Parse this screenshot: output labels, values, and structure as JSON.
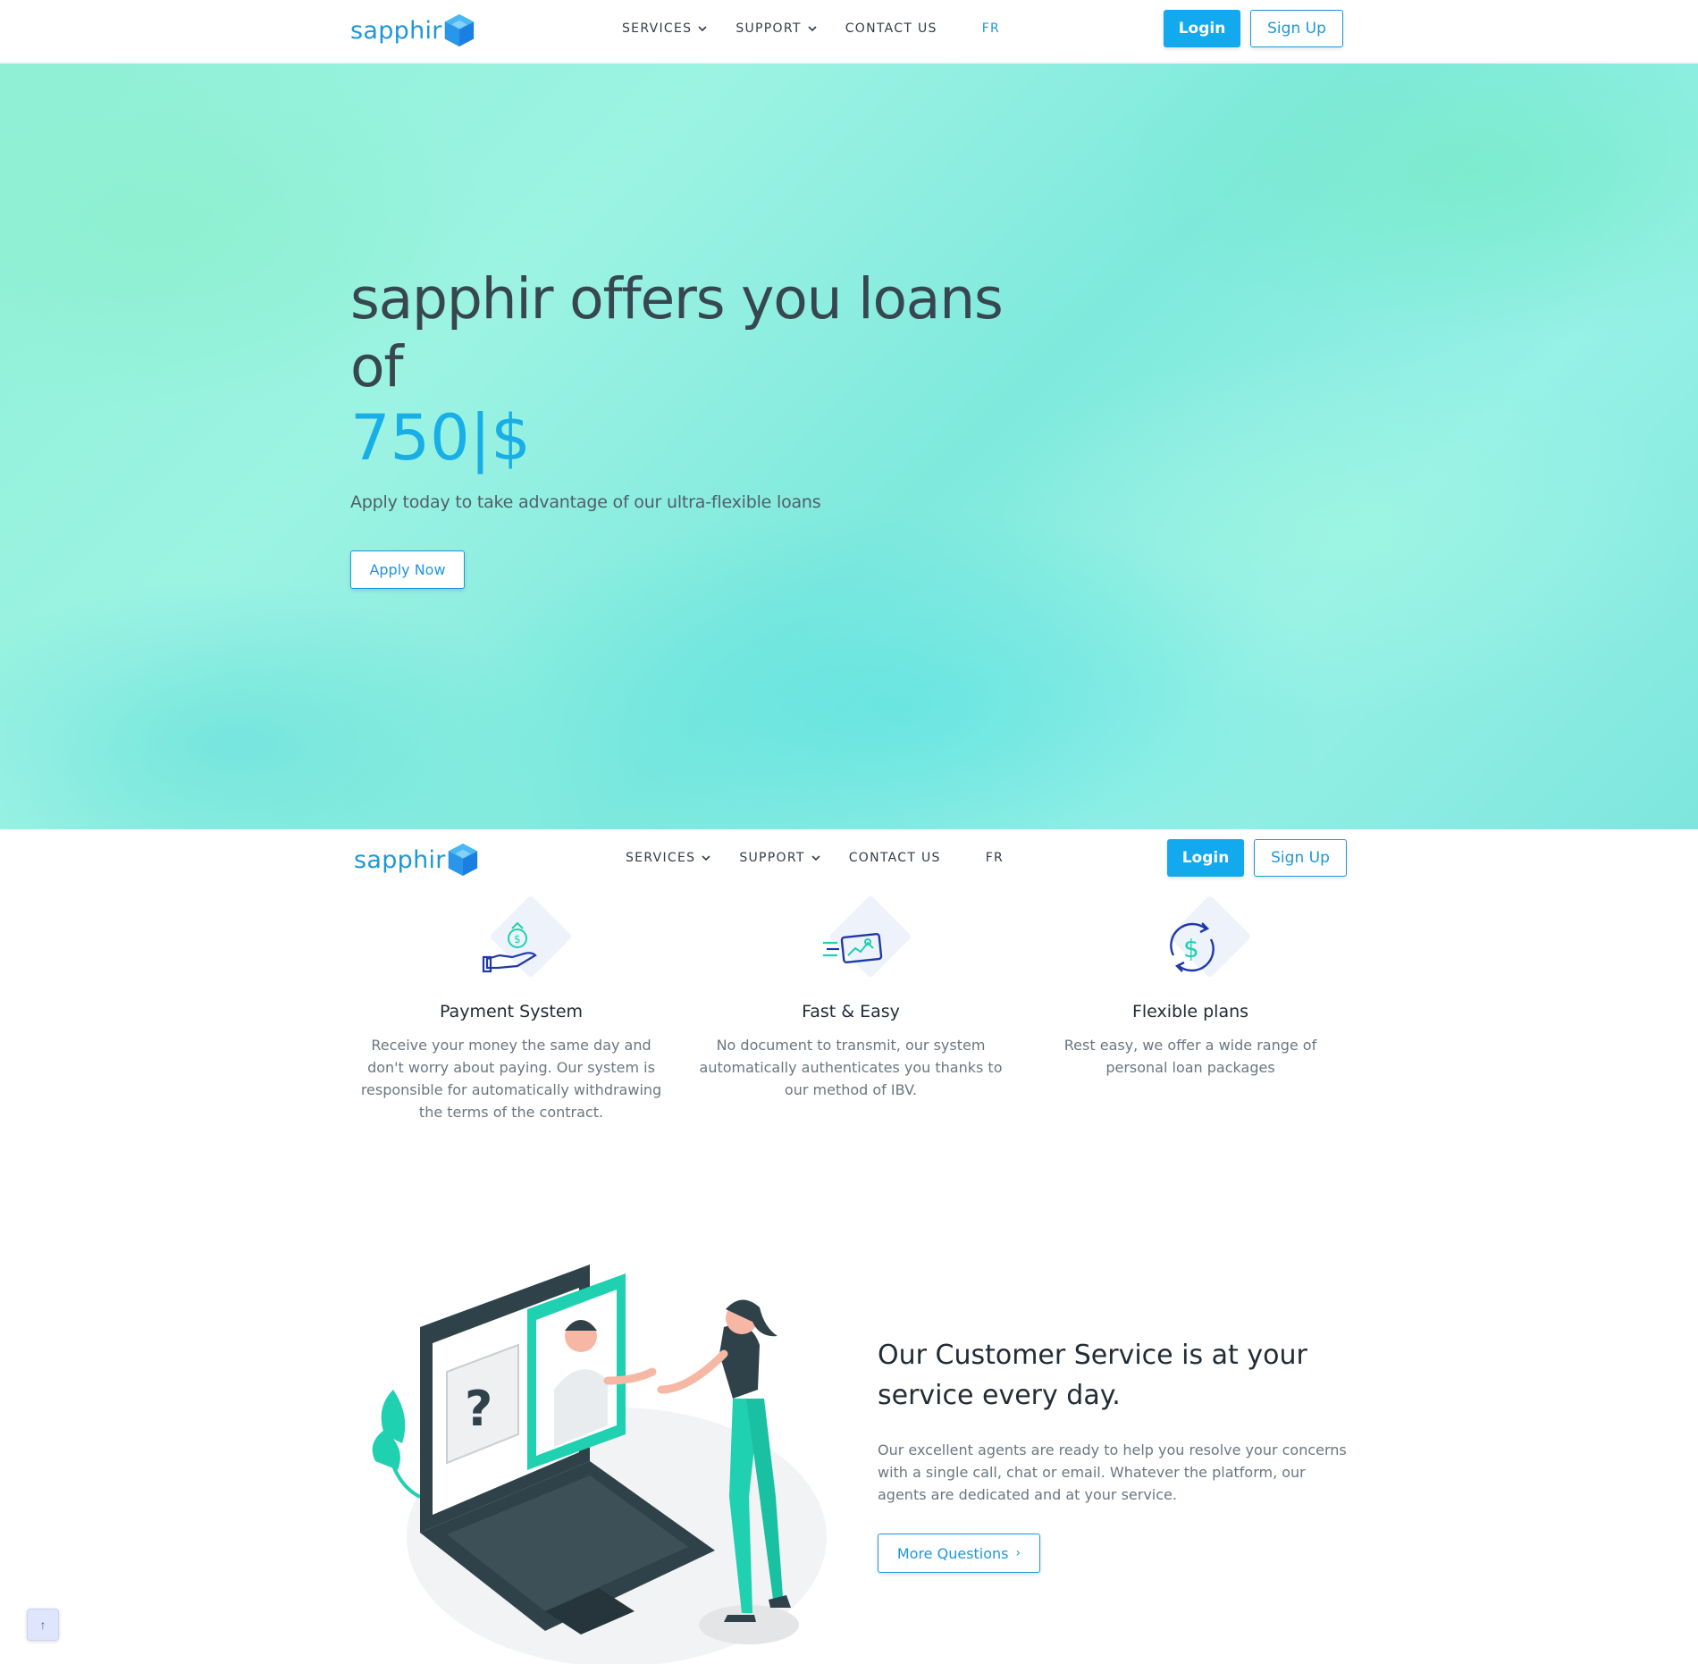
{
  "brand": {
    "name": "sapphir",
    "icon": "hexagon-gem-icon",
    "colors": {
      "primary": "#12a9ee",
      "accent_text": "#1e97d9",
      "heading": "#37474f",
      "teal": "#1fd1b0"
    }
  },
  "nav": {
    "services": "SERVICES",
    "support": "SUPPORT",
    "contact": "CONTACT US",
    "language": "FR",
    "login": "Login",
    "signup": "Sign Up"
  },
  "hero": {
    "title": "sapphir offers you loans of",
    "amount": "750|$",
    "subtitle": "Apply today to take advantage of our ultra-flexible loans",
    "cta": "Apply Now"
  },
  "features": [
    {
      "icon": "money-hand-icon",
      "title": "Payment System",
      "text": "Receive your money the same day and don't worry about paying. Our system is responsible for automatically withdrawing the terms of the contract."
    },
    {
      "icon": "fast-card-icon",
      "title": "Fast & Easy",
      "text": "No document to transmit, our system automatically authenticates you thanks to our method of IBV."
    },
    {
      "icon": "dollar-cycle-icon",
      "title": "Flexible plans",
      "text": "Rest easy, we offer a wide range of personal loan packages"
    }
  ],
  "customer_service": {
    "title": "Our Customer Service is at your service every day.",
    "text": "Our excellent agents are ready to help you resolve your concerns with a single call, chat or email. Whatever the platform, our agents are dedicated and at your service.",
    "cta": "More Questions",
    "cta_icon": "chevron-right-icon"
  },
  "scroll_top": {
    "icon": "arrow-up-icon"
  }
}
